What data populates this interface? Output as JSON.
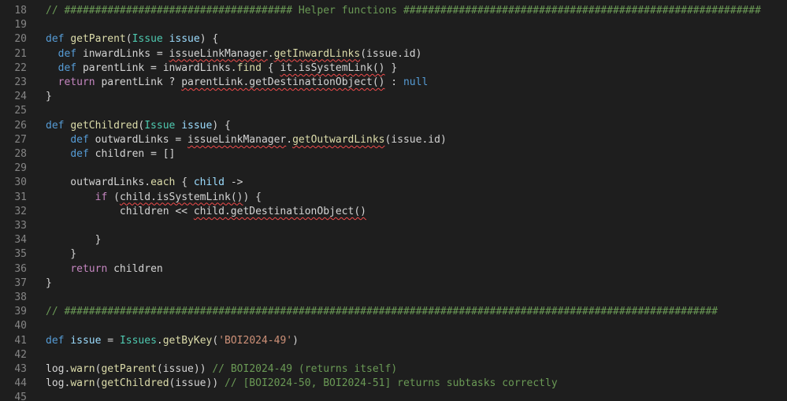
{
  "editor": {
    "lines": [
      {
        "n": "18",
        "tokens": [
          {
            "c": "cm",
            "t": "// ##################################### Helper functions ##########################################################"
          }
        ]
      },
      {
        "n": "19",
        "tokens": []
      },
      {
        "n": "20",
        "tokens": [
          {
            "c": "kw",
            "t": "def"
          },
          {
            "c": "",
            "t": " "
          },
          {
            "c": "fn",
            "t": "getParent"
          },
          {
            "c": "",
            "t": "("
          },
          {
            "c": "ty",
            "t": "Issue"
          },
          {
            "c": "",
            "t": " "
          },
          {
            "c": "prm",
            "t": "issue"
          },
          {
            "c": "",
            "t": ") {"
          }
        ]
      },
      {
        "n": "21",
        "tokens": [
          {
            "c": "",
            "t": "  "
          },
          {
            "c": "kw",
            "t": "def"
          },
          {
            "c": "",
            "t": " inwardLinks = "
          },
          {
            "c": "sq",
            "t": "issueLinkManager"
          },
          {
            "c": "",
            "t": "."
          },
          {
            "c": "fn sq",
            "t": "getInwardLinks"
          },
          {
            "c": "",
            "t": "(issue.id)"
          }
        ]
      },
      {
        "n": "22",
        "tokens": [
          {
            "c": "",
            "t": "  "
          },
          {
            "c": "kw",
            "t": "def"
          },
          {
            "c": "",
            "t": " parentLink = inwardLinks."
          },
          {
            "c": "fn",
            "t": "find"
          },
          {
            "c": "",
            "t": " { "
          },
          {
            "c": "sq",
            "t": "it.isSystemLink()"
          },
          {
            "c": "",
            "t": " }"
          }
        ]
      },
      {
        "n": "23",
        "tokens": [
          {
            "c": "",
            "t": "  "
          },
          {
            "c": "ctl",
            "t": "return"
          },
          {
            "c": "",
            "t": " parentLink ? "
          },
          {
            "c": "sq",
            "t": "parentLink.getDestinationObject()"
          },
          {
            "c": "",
            "t": " : "
          },
          {
            "c": "kw",
            "t": "null"
          }
        ]
      },
      {
        "n": "24",
        "tokens": [
          {
            "c": "",
            "t": "}"
          }
        ]
      },
      {
        "n": "25",
        "tokens": []
      },
      {
        "n": "26",
        "tokens": [
          {
            "c": "kw",
            "t": "def"
          },
          {
            "c": "",
            "t": " "
          },
          {
            "c": "fn",
            "t": "getChildred"
          },
          {
            "c": "",
            "t": "("
          },
          {
            "c": "ty",
            "t": "Issue"
          },
          {
            "c": "",
            "t": " "
          },
          {
            "c": "prm",
            "t": "issue"
          },
          {
            "c": "",
            "t": ") {"
          }
        ]
      },
      {
        "n": "27",
        "tokens": [
          {
            "c": "",
            "t": "    "
          },
          {
            "c": "kw",
            "t": "def"
          },
          {
            "c": "",
            "t": " outwardLinks = "
          },
          {
            "c": "sq",
            "t": "issueLinkManager"
          },
          {
            "c": "",
            "t": "."
          },
          {
            "c": "fn sq",
            "t": "getOutwardLinks"
          },
          {
            "c": "",
            "t": "(issue.id)"
          }
        ]
      },
      {
        "n": "28",
        "tokens": [
          {
            "c": "",
            "t": "    "
          },
          {
            "c": "kw",
            "t": "def"
          },
          {
            "c": "",
            "t": " children = []"
          }
        ]
      },
      {
        "n": "29",
        "tokens": []
      },
      {
        "n": "30",
        "tokens": [
          {
            "c": "",
            "t": "    outwardLinks."
          },
          {
            "c": "fn",
            "t": "each"
          },
          {
            "c": "",
            "t": " { "
          },
          {
            "c": "prm",
            "t": "child"
          },
          {
            "c": "",
            "t": " ->"
          }
        ]
      },
      {
        "n": "31",
        "tokens": [
          {
            "c": "",
            "t": "        "
          },
          {
            "c": "ctl",
            "t": "if"
          },
          {
            "c": "",
            "t": " ("
          },
          {
            "c": "sq",
            "t": "child.isSystemLink()"
          },
          {
            "c": "",
            "t": ") {"
          }
        ]
      },
      {
        "n": "32",
        "tokens": [
          {
            "c": "",
            "t": "            children << "
          },
          {
            "c": "sq",
            "t": "child.getDestinationObject()"
          }
        ]
      },
      {
        "n": "33",
        "tokens": []
      },
      {
        "n": "34",
        "tokens": [
          {
            "c": "",
            "t": "        }"
          }
        ]
      },
      {
        "n": "35",
        "tokens": [
          {
            "c": "",
            "t": "    }"
          }
        ]
      },
      {
        "n": "36",
        "tokens": [
          {
            "c": "",
            "t": "    "
          },
          {
            "c": "ctl",
            "t": "return"
          },
          {
            "c": "",
            "t": " children"
          }
        ]
      },
      {
        "n": "37",
        "tokens": [
          {
            "c": "",
            "t": "}"
          }
        ]
      },
      {
        "n": "38",
        "tokens": []
      },
      {
        "n": "39",
        "tokens": [
          {
            "c": "cm",
            "t": "// ##########################################################################################################"
          }
        ]
      },
      {
        "n": "40",
        "tokens": []
      },
      {
        "n": "41",
        "tokens": [
          {
            "c": "kw",
            "t": "def"
          },
          {
            "c": "",
            "t": " "
          },
          {
            "c": "prm",
            "t": "issue"
          },
          {
            "c": "",
            "t": " = "
          },
          {
            "c": "ty",
            "t": "Issues"
          },
          {
            "c": "",
            "t": "."
          },
          {
            "c": "fn",
            "t": "getByKey"
          },
          {
            "c": "",
            "t": "("
          },
          {
            "c": "str",
            "t": "'BOI2024-49'"
          },
          {
            "c": "",
            "t": ")"
          }
        ]
      },
      {
        "n": "42",
        "tokens": []
      },
      {
        "n": "43",
        "tokens": [
          {
            "c": "",
            "t": "log."
          },
          {
            "c": "fn",
            "t": "warn"
          },
          {
            "c": "",
            "t": "("
          },
          {
            "c": "fn",
            "t": "getParent"
          },
          {
            "c": "",
            "t": "(issue)) "
          },
          {
            "c": "cm",
            "t": "// BOI2024-49 (returns itself)"
          }
        ]
      },
      {
        "n": "44",
        "tokens": [
          {
            "c": "",
            "t": "log."
          },
          {
            "c": "fn",
            "t": "warn"
          },
          {
            "c": "",
            "t": "("
          },
          {
            "c": "fn",
            "t": "getChildred"
          },
          {
            "c": "",
            "t": "(issue)) "
          },
          {
            "c": "cm",
            "t": "// [BOI2024-50, BOI2024-51] returns subtasks correctly"
          }
        ]
      },
      {
        "n": "45",
        "tokens": []
      }
    ]
  },
  "colors": {
    "background": "#1e1e1e",
    "line_number": "#858585",
    "keyword": "#569cd6",
    "control": "#c586c0",
    "function": "#dcdcaa",
    "type": "#4ec9b0",
    "parameter": "#9cdcfe",
    "string": "#ce9178",
    "comment": "#6a9955",
    "squiggle": "#f14c4c"
  }
}
